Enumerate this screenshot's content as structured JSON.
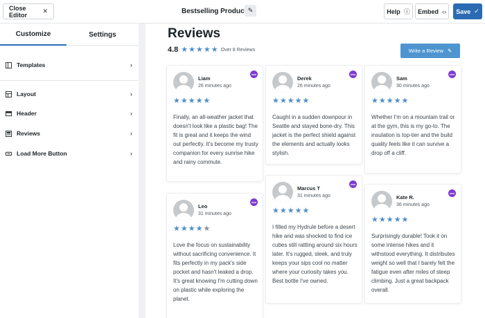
{
  "topbar": {
    "close_label": "Close Editor",
    "title": "Bestselling Products",
    "help_label": "Help",
    "embed_label": "Embed",
    "save_label": "Save"
  },
  "sidebar": {
    "tabs": [
      {
        "label": "Customize",
        "active": true
      },
      {
        "label": "Settings",
        "active": false
      }
    ],
    "items": [
      {
        "label": "Templates",
        "icon": "templates-icon"
      },
      {
        "label": "Layout",
        "icon": "layout-icon"
      },
      {
        "label": "Header",
        "icon": "header-icon"
      },
      {
        "label": "Reviews",
        "icon": "reviews-icon"
      },
      {
        "label": "Load More Button",
        "icon": "load-more-icon"
      }
    ]
  },
  "main": {
    "title": "Reviews",
    "rating": "4.8",
    "rating_sub": "Over 8 Reviews",
    "write_label": "Write a Review"
  },
  "reviews": [
    {
      "name": "Liam",
      "time": "26 minutes ago",
      "stars": 5,
      "badge": "woo",
      "text": "Finally, an all-weather jacket that doesn't look like a plastic bag! The fit is great and it keeps the wind out perfectly. It's become my trusty companion for every sunrise hike and rainy commute."
    },
    {
      "name": "Derek",
      "time": "26 minutes ago",
      "stars": 5,
      "badge": "woo",
      "text": "Caught in a sudden downpour in Seattle and stayed bone-dry. This jacket is the perfect shield against the elements and actually looks stylish."
    },
    {
      "name": "Sam",
      "time": "30 minutes ago",
      "stars": 5,
      "badge": "woo",
      "text": "Whether I'm on a mountain trail or at the gym, this is my go-to. The insulation is top-tier and the build quality feels like it can survive a drop off a cliff."
    },
    {
      "name": "Leo",
      "time": "31 minutes ago",
      "stars": 4,
      "badge": "woo",
      "text": "Love the focus on sustainability without sacrificing convenience. It fits perfectly in my pack's side pocket and hasn't leaked a drop. It's great knowing I'm cutting down on plastic while exploring the planet."
    },
    {
      "name": "Marcus T",
      "time": "31 minutes ago",
      "stars": 5,
      "badge": "woo",
      "text": "I filled my Hydrule before a desert hike and was shocked to find ice cubes still rattling around six hours later. It's rugged, sleek, and truly keeps your sips cool no matter where your curiosity takes you. Best bottle I've owned."
    },
    {
      "name": "Kate R.",
      "time": "36 minutes ago",
      "stars": 5,
      "badge": "woo",
      "text": "Surprisingly durable! Took it on some intense hikes and it withstood everything. It distributes weight so well that I barely felt the fatigue even after miles of steep climbing. Just a great backpack overall."
    }
  ],
  "colors": {
    "accent": "#2a6bb3",
    "star": "#4e8ec9",
    "badge": "#7e3bd0"
  }
}
